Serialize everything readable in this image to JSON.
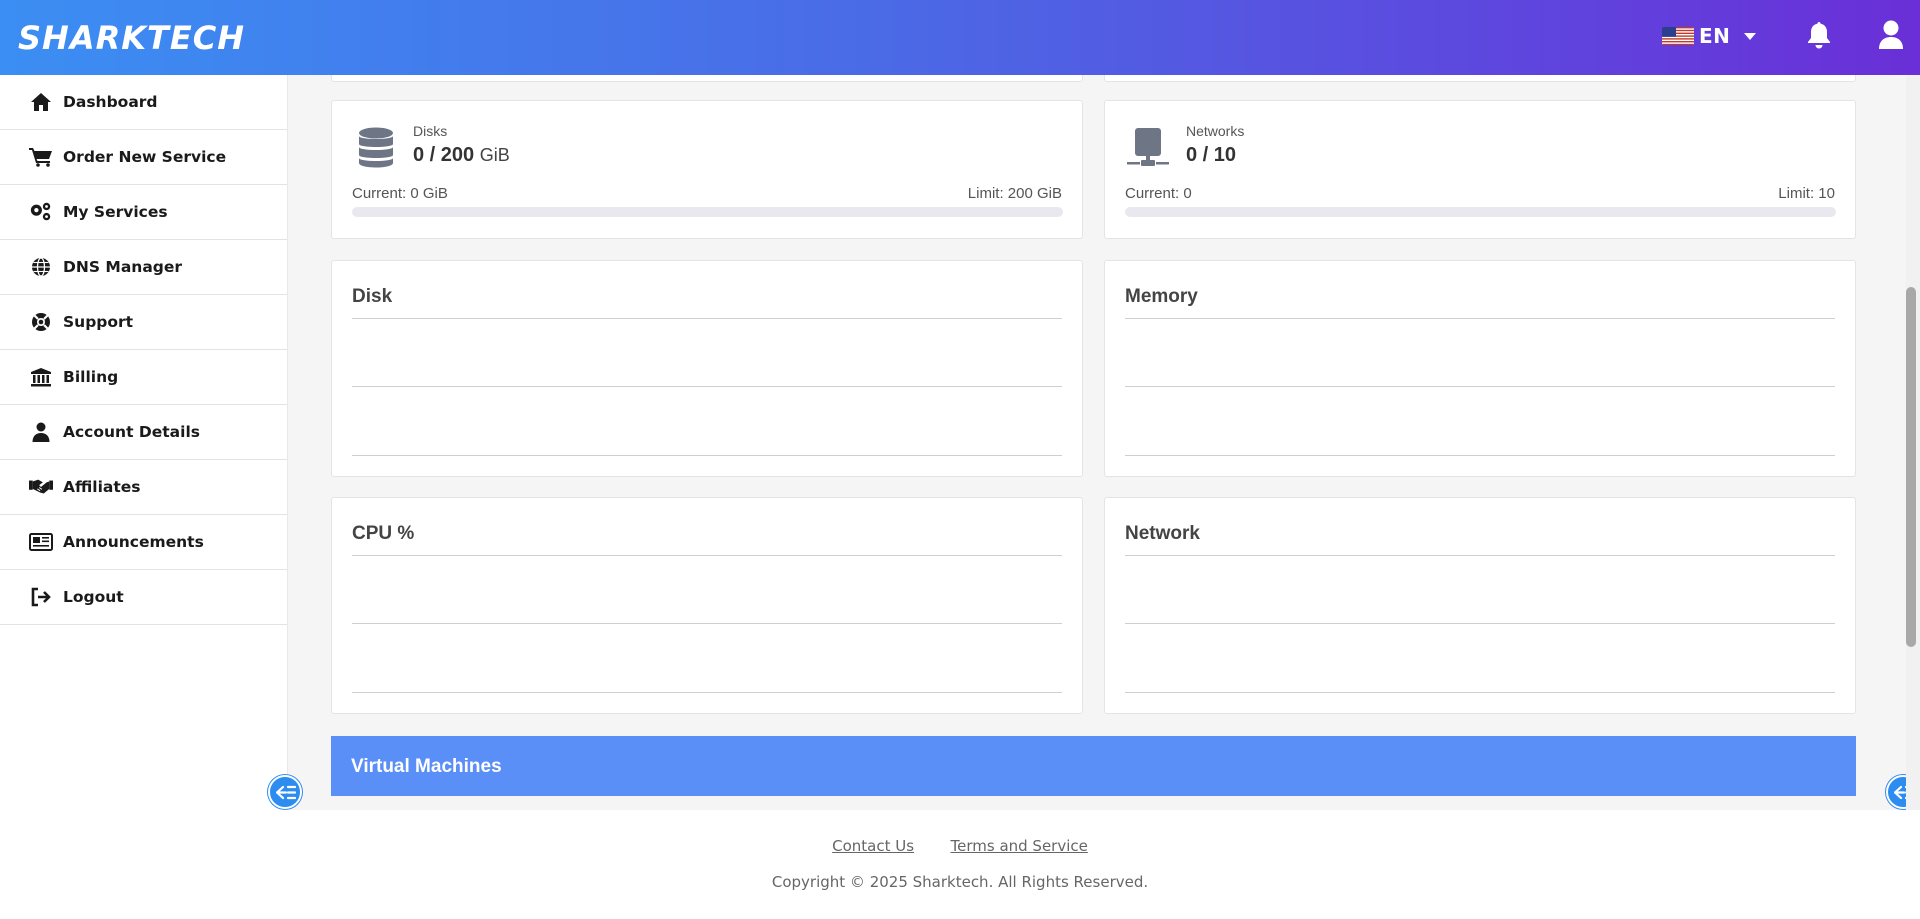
{
  "header": {
    "brand": "SHARKTECH",
    "language": "EN"
  },
  "sidebar": {
    "items": [
      {
        "label": "Dashboard",
        "icon": "home-icon"
      },
      {
        "label": "Order New Service",
        "icon": "cart-icon"
      },
      {
        "label": "My Services",
        "icon": "gears-icon"
      },
      {
        "label": "DNS Manager",
        "icon": "globe-icon"
      },
      {
        "label": "Support",
        "icon": "lifebuoy-icon"
      },
      {
        "label": "Billing",
        "icon": "bank-icon"
      },
      {
        "label": "Account Details",
        "icon": "user-icon"
      },
      {
        "label": "Affiliates",
        "icon": "handshake-icon"
      },
      {
        "label": "Announcements",
        "icon": "newspaper-icon"
      },
      {
        "label": "Logout",
        "icon": "logout-icon"
      }
    ]
  },
  "stats": {
    "disks": {
      "title": "Disks",
      "value": "0 / 200",
      "unit": "GiB",
      "current": "Current: 0 GiB",
      "limit": "Limit: 200 GiB",
      "fraction": 0
    },
    "networks": {
      "title": "Networks",
      "value": "0 / 10",
      "current": "Current: 0",
      "limit": "Limit: 10",
      "fraction": 0
    }
  },
  "charts": {
    "disk": "Disk",
    "memory": "Memory",
    "cpu": "CPU %",
    "network": "Network"
  },
  "vm": {
    "title": "Virtual Machines"
  },
  "footer": {
    "contact": "Contact Us",
    "terms": "Terms and Service",
    "copyright": "Copyright © 2025 Sharktech. All Rights Reserved."
  },
  "colors": {
    "header_start": "#3b8ef3",
    "header_end": "#6a2fd8",
    "vm_bar": "#5b8ff8",
    "accent": "#2d8cf0"
  }
}
